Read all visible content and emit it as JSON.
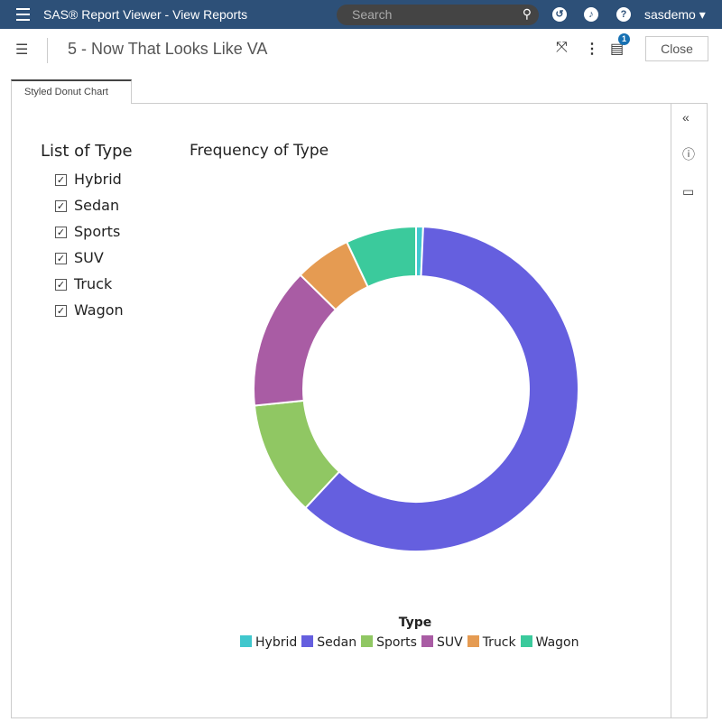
{
  "app": {
    "title": "SAS® Report Viewer - View Reports",
    "search_placeholder": "Search",
    "user": "sasdemo ▾"
  },
  "report": {
    "title": "5 - Now That Looks Like VA",
    "close_label": "Close",
    "notes_badge": "1"
  },
  "tab": {
    "label": "Styled Donut Chart"
  },
  "list": {
    "title": "List of Type",
    "items": [
      {
        "label": "Hybrid",
        "checked": true
      },
      {
        "label": "Sedan",
        "checked": true
      },
      {
        "label": "Sports",
        "checked": true
      },
      {
        "label": "SUV",
        "checked": true
      },
      {
        "label": "Truck",
        "checked": true
      },
      {
        "label": "Wagon",
        "checked": true
      }
    ]
  },
  "chart_data": {
    "type": "pie",
    "variant": "donut",
    "title": "Frequency of Type",
    "legend_title": "Type",
    "legend_placement": "bottom",
    "categories": [
      "Hybrid",
      "Sedan",
      "Sports",
      "SUV",
      "Truck",
      "Wagon"
    ],
    "values": [
      3,
      262,
      49,
      60,
      24,
      30
    ],
    "colors": [
      "#1fbdc4",
      "#4a43d9",
      "#7dbd48",
      "#9a3f94",
      "#e08a34",
      "#19c18b"
    ]
  }
}
